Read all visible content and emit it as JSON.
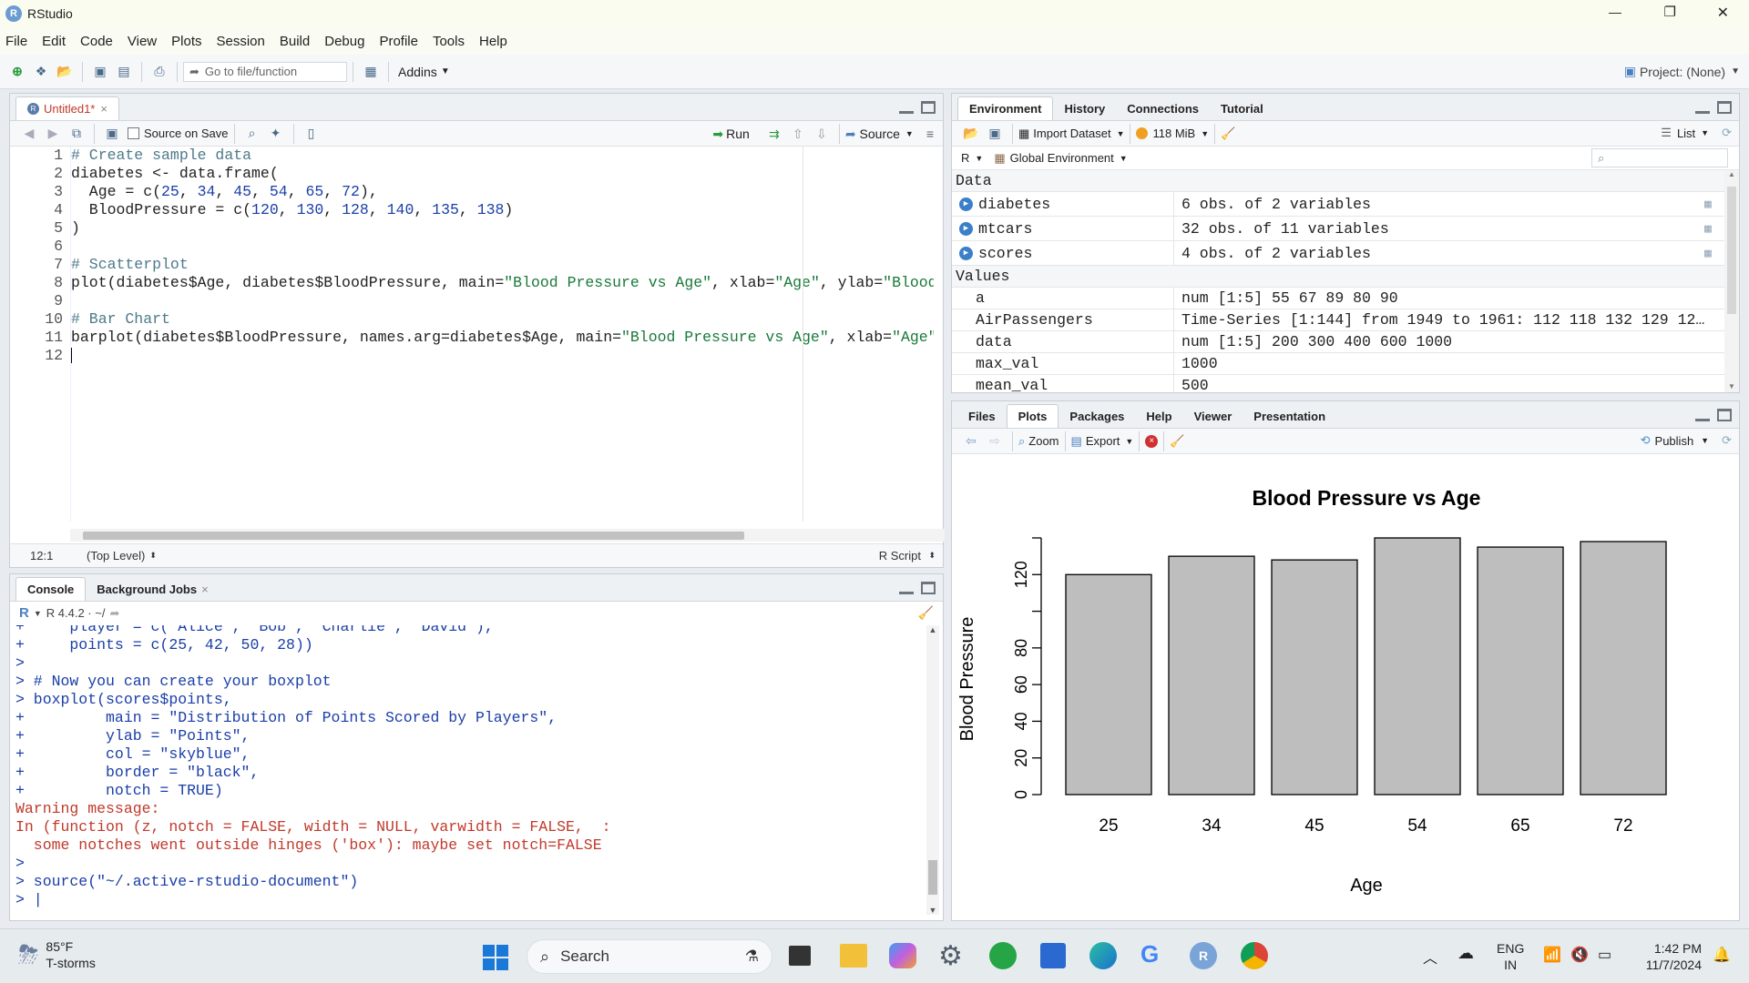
{
  "window": {
    "title": "RStudio",
    "minimize": "—",
    "maximize": "❐",
    "close": "✕"
  },
  "menu": [
    "File",
    "Edit",
    "Code",
    "View",
    "Plots",
    "Session",
    "Build",
    "Debug",
    "Profile",
    "Tools",
    "Help"
  ],
  "toolbar": {
    "goto_placeholder": "Go to file/function",
    "addins": "Addins",
    "project": "Project: (None)"
  },
  "editor": {
    "tab": "Untitled1*",
    "source_on_save": "Source on Save",
    "run": "Run",
    "source": "Source",
    "status_pos": "12:1",
    "status_scope": "(Top Level)",
    "status_type": "R Script",
    "line_numbers": [
      "1",
      "2",
      "3",
      "4",
      "5",
      "6",
      "7",
      "8",
      "9",
      "10",
      "11",
      "12"
    ]
  },
  "env": {
    "tabs": [
      "Environment",
      "History",
      "Connections",
      "Tutorial"
    ],
    "import": "Import Dataset",
    "memory": "118 MiB",
    "view": "List",
    "lang": "R",
    "scope": "Global Environment",
    "section_data": "Data",
    "section_values": "Values",
    "data": [
      {
        "name": "diabetes",
        "value": "6 obs. of 2 variables"
      },
      {
        "name": "mtcars",
        "value": "32 obs. of 11 variables"
      },
      {
        "name": "scores",
        "value": "4 obs. of 2 variables"
      }
    ],
    "values": [
      {
        "name": "a",
        "value": "num [1:5] 55 67 89 80 90"
      },
      {
        "name": "AirPassengers",
        "value": "Time-Series [1:144] from 1949 to 1961: 112 118 132 129 12…"
      },
      {
        "name": "data",
        "value": "num [1:5] 200 300 400 600 1000"
      },
      {
        "name": "max_val",
        "value": "1000"
      },
      {
        "name": "mean_val",
        "value": "500"
      }
    ]
  },
  "console": {
    "tabs": [
      "Console",
      "Background Jobs"
    ],
    "version": "R 4.4.2 · ~/"
  },
  "files": {
    "tabs": [
      "Files",
      "Plots",
      "Packages",
      "Help",
      "Viewer",
      "Presentation"
    ],
    "zoom": "Zoom",
    "export": "Export",
    "publish": "Publish"
  },
  "chart_data": {
    "type": "bar",
    "title": "Blood Pressure vs Age",
    "xlabel": "Age",
    "ylabel": "Blood Pressure",
    "categories": [
      "25",
      "34",
      "45",
      "54",
      "65",
      "72"
    ],
    "values": [
      120,
      130,
      128,
      140,
      135,
      138
    ],
    "ylim": [
      0,
      140
    ],
    "yticks": [
      0,
      20,
      40,
      60,
      80,
      120
    ],
    "bar_color": "#bebebe"
  },
  "taskbar": {
    "temp": "85°F",
    "weather": "T-storms",
    "search": "Search",
    "lang1": "ENG",
    "lang2": "IN",
    "time": "1:42 PM",
    "date": "11/7/2024"
  }
}
